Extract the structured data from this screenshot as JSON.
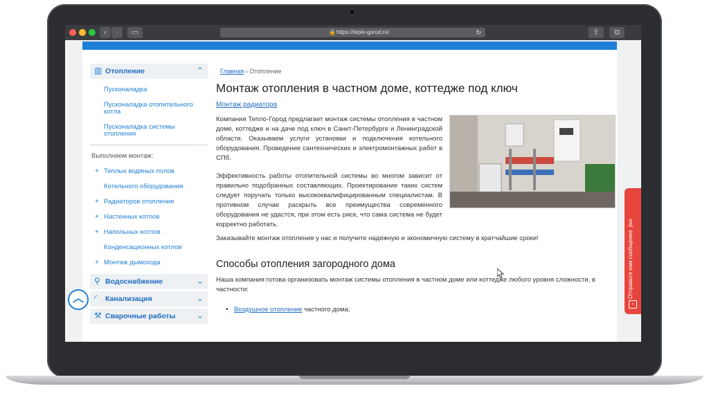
{
  "browser": {
    "url": "https://teplo-gorod.ru/",
    "back_glyph": "‹",
    "forward_glyph": "›",
    "reload_glyph": "↻",
    "lock_glyph": "🔒",
    "sidebar_glyph": "▭",
    "share_glyph": "⇪",
    "tabs_glyph": "⧉"
  },
  "sidebar": {
    "heating": {
      "title": "Отопление",
      "icon": "radiator-icon",
      "chevron": "⌃"
    },
    "heating_items": [
      "Пусконаладка",
      "Пусконаладка отопительного котла",
      "Пусконаладка системы отопления"
    ],
    "section_label": "Выполняем монтаж:",
    "install_items": [
      {
        "label": "Теплых водяных полов",
        "plus": "+"
      },
      {
        "label": "Котельного оборудования",
        "plus": ""
      },
      {
        "label": "Радиаторов отопления",
        "plus": "+"
      },
      {
        "label": "Настенных котлов",
        "plus": "+"
      },
      {
        "label": "Напольных котлов",
        "plus": "+"
      },
      {
        "label": "Конденсационных котлов",
        "plus": ""
      },
      {
        "label": "Монтаж дымохода",
        "plus": "+"
      }
    ],
    "categories": [
      {
        "title": "Водоснабжение",
        "icon": "faucet-icon",
        "chevron": "⌄"
      },
      {
        "title": "Канализация",
        "icon": "pipe-icon",
        "chevron": "⌄"
      },
      {
        "title": "Сварочные работы",
        "icon": "welding-icon",
        "chevron": "⌄"
      }
    ],
    "scroll_up_glyph": "︿"
  },
  "main": {
    "breadcrumb_home": "Главная",
    "breadcrumb_sep": "›",
    "breadcrumb_current": "Отопление",
    "title": "Монтаж отопления в частном доме, коттедже под ключ",
    "sub_link": "Монтаж радиатора",
    "para1": "Компания Тепло-Город предлагает монтаж системы отопления в частном доме, коттедже и на даче под ключ в Санкт-Петербурге и Ленинградской области. Оказываем услуги установки и подключения котельного оборудования. Проведение сантехнических и электромонтажных работ в СПб.",
    "para2": "Эффективность работы отопительной системы во многом зависит от правильно подобранных составляющих. Проектирование таких систем следует поручать только высококвалифицированным специалистам. В противном случае раскрыть все преимущества современного оборудования не удастся, при этом есть риск, что сама система не будет корректно работать.",
    "para3": "Заказывайте монтаж отопления у нас и получите надежную и экономичную систему в кратчайшие сроки!",
    "h2": "Способы отопления загородного дома",
    "para4": "Наша компания готова организовать монтаж системы отопления в частном доме или коттедже любого уровня сложности, в частности:",
    "bullet_link": "Воздушное отопление",
    "bullet_rest": " частного дома;"
  },
  "feedback": {
    "text": "Отправьте нам сообщение",
    "brand": "jivo",
    "icon_glyph": "›"
  }
}
